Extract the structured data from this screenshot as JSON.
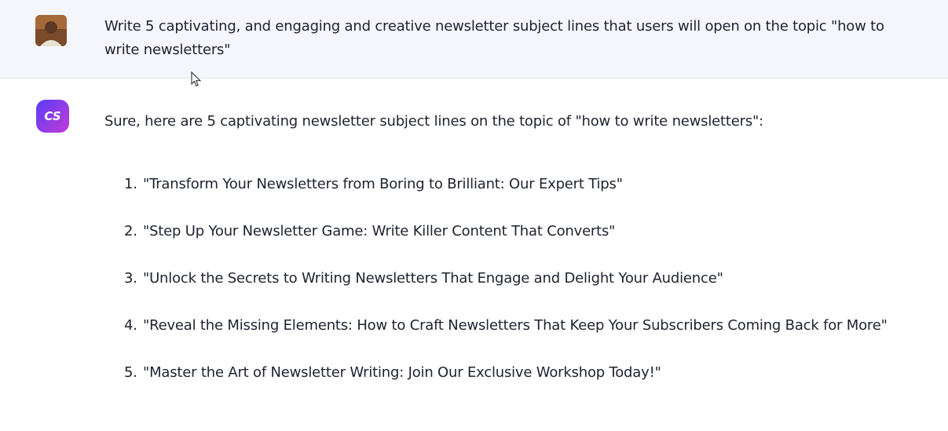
{
  "user": {
    "message": "Write 5 captivating, and engaging and creative newsletter subject lines that users will open on the topic \"how to write newsletters\""
  },
  "assistant": {
    "avatar_text": "CS",
    "intro": "Sure, here are 5 captivating newsletter subject lines on the topic of \"how to write newsletters\":",
    "items": [
      {
        "num": "1.",
        "text": "\"Transform Your Newsletters from Boring to Brilliant: Our Expert Tips\""
      },
      {
        "num": "2.",
        "text": "\"Step Up Your Newsletter Game: Write Killer Content That Converts\""
      },
      {
        "num": "3.",
        "text": "\"Unlock the Secrets to Writing Newsletters That Engage and Delight Your Audience\""
      },
      {
        "num": "4.",
        "text": "\"Reveal the Missing Elements: How to Craft Newsletters That Keep Your Subscribers Coming Back for More\""
      },
      {
        "num": "5.",
        "text": "\"Master the Art of Newsletter Writing: Join Our Exclusive Workshop Today!\""
      }
    ]
  },
  "colors": {
    "user_bg": "#f5f6fb",
    "brand_gradient_start": "#5b3df5",
    "brand_gradient_end": "#c03bd8"
  }
}
